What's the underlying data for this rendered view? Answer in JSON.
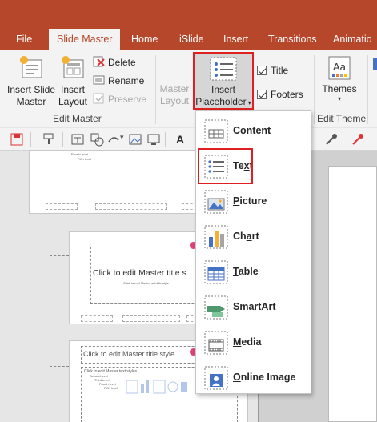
{
  "tabs": [
    {
      "label": "File"
    },
    {
      "label": "Slide Master"
    },
    {
      "label": "Home"
    },
    {
      "label": "iSlide"
    },
    {
      "label": "Insert"
    },
    {
      "label": "Transitions"
    },
    {
      "label": "Animatio"
    }
  ],
  "ribbon": {
    "insert_slide_master": [
      "Insert Slide",
      "Master"
    ],
    "insert_layout": [
      "Insert",
      "Layout"
    ],
    "delete": "Delete",
    "rename": "Rename",
    "preserve": "Preserve",
    "edit_master_group": "Edit Master",
    "master_layout": [
      "Master",
      "Layout"
    ],
    "insert_placeholder": [
      "Insert",
      "Placeholder"
    ],
    "title_check": "Title",
    "footers_check": "Footers",
    "themes": "Themes",
    "edit_theme_group": "Edit Theme"
  },
  "dropdown": {
    "items": [
      {
        "label": "Content",
        "key": "C"
      },
      {
        "label": "Text",
        "key": "x"
      },
      {
        "label": "Picture",
        "key": "P"
      },
      {
        "label": "Chart",
        "key": "a"
      },
      {
        "label": "Table",
        "key": "T"
      },
      {
        "label": "SmartArt",
        "key": "S"
      },
      {
        "label": "Media",
        "key": "M"
      },
      {
        "label": "Online Image",
        "key": "O"
      }
    ]
  },
  "thumbnails": {
    "slide1_lines": [
      "Fourth level",
      "Fifth level"
    ],
    "slide2_title": "Click to edit Master title s",
    "slide2_subtitle": "Click to edit Master subtitle style",
    "slide3_title": "Click to edit Master title style",
    "slide3_body": [
      "Click to edit Master text styles",
      "Second level",
      "Third level",
      "Fourth level",
      "Fifth level"
    ]
  },
  "colors": {
    "accent": "#b7472a",
    "highlight": "#e02020",
    "ribbon_bg": "#f3f3f3"
  }
}
